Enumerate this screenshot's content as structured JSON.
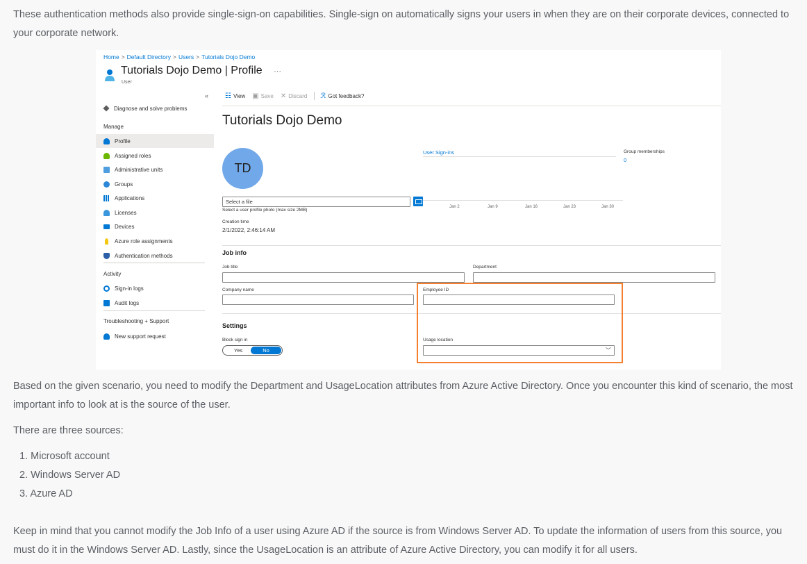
{
  "article": {
    "para1": "These authentication methods also provide single-sign-on capabilities. Single-sign on automatically signs your users in when they are on their corporate devices, connected to your corporate network.",
    "para2": "Based on the given scenario, you need to modify the Department and UsageLocation attributes from Azure Active Directory. Once you encounter this kind of scenario, the most important info to look at is the source of the user.",
    "para3": "There are three sources:",
    "sources": [
      "1. Microsoft account",
      "2. Windows Server AD",
      "3. Azure AD"
    ],
    "para4": "Keep in mind that you cannot modify the Job Info of a user using Azure AD if the source is from Windows Server AD. To update the information of users from this source, you must do it in the Windows Server AD. Lastly, since the UsageLocation is an attribute of Azure Active Directory, you can modify it for all users."
  },
  "portal": {
    "breadcrumb": [
      "Home",
      "Default Directory",
      "Users",
      "Tutorials Dojo Demo"
    ],
    "header": {
      "name": "Tutorials Dojo Demo",
      "section": "| Profile",
      "more": "···",
      "subtitle": "User"
    },
    "collapse": "«",
    "nav": {
      "diagnose": "Diagnose and solve problems",
      "manage_heading": "Manage",
      "manage": [
        "Profile",
        "Assigned roles",
        "Administrative units",
        "Groups",
        "Applications",
        "Licenses",
        "Devices",
        "Azure role assignments",
        "Authentication methods"
      ],
      "activity_heading": "Activity",
      "activity": [
        "Sign-in logs",
        "Audit logs"
      ],
      "support_heading": "Troubleshooting + Support",
      "support": [
        "New support request"
      ]
    },
    "toolbar": {
      "view": "View",
      "save": "Save",
      "discard": "Discard",
      "feedback": "Got feedback?"
    },
    "profile": {
      "title": "Tutorials Dojo Demo",
      "initials": "TD",
      "file_placeholder": "Select a file",
      "file_hint": "Select a user profile photo (max size 2MB)",
      "creation_label": "Creation time",
      "creation_value": "2/1/2022, 2:46:14 AM",
      "sign_ins_link": "User Sign-ins",
      "group_label": "Group memberships",
      "group_value": "0",
      "chart_ticks": [
        "Jan 2",
        "Jan 9",
        "Jan 16",
        "Jan 23",
        "Jan 30"
      ]
    },
    "job_info": {
      "heading": "Job info",
      "job_title": "Job title",
      "department": "Department",
      "company": "Company name",
      "employee_id": "Employee ID"
    },
    "settings": {
      "heading": "Settings",
      "block_label": "Block sign in",
      "yes": "Yes",
      "no": "No",
      "usage_label": "Usage location"
    }
  }
}
